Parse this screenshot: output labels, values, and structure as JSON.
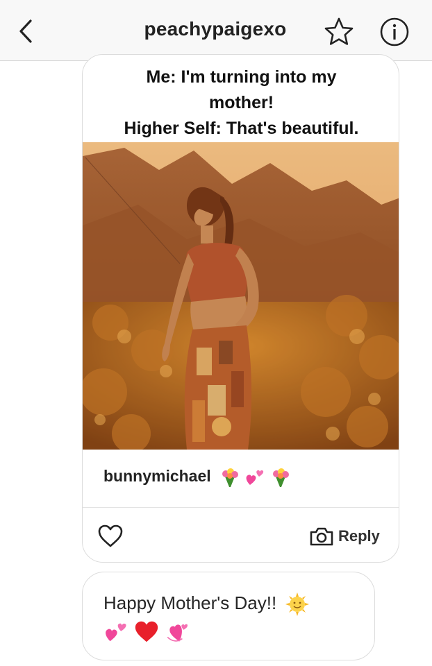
{
  "header": {
    "username": "peachypaigexo",
    "back_icon": "chevron-left-icon",
    "star_icon": "star-outline-icon",
    "info_icon": "info-circle-icon"
  },
  "shared_post": {
    "caption_lines": [
      "Me: I'm turning into my",
      "mother!",
      "Higher Self: That's beautiful."
    ],
    "author": "bunnymichael",
    "author_emojis": [
      "bouquet",
      "two-hearts",
      "bouquet"
    ],
    "like_icon": "heart-outline-icon",
    "reply_icon": "camera-icon",
    "reply_label": "Reply"
  },
  "message": {
    "text": "Happy Mother's Day!!",
    "emojis": [
      "sun-with-face",
      "two-hearts",
      "red-heart",
      "revolving-hearts"
    ]
  },
  "colors": {
    "header_bg": "#f8f8f8",
    "border": "#dcdcdc",
    "text": "#222222",
    "heart_red": "#e8202b",
    "heart_pink": "#f0479a",
    "photo_sepia": "#b56a35"
  }
}
